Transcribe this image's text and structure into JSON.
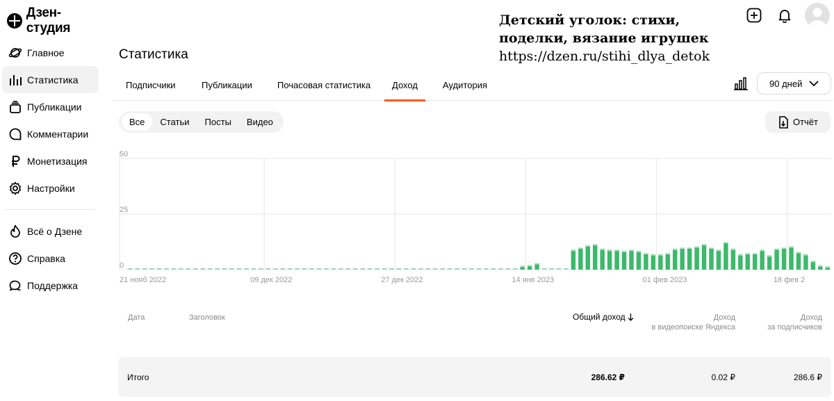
{
  "app": {
    "title": "Дзен-студия"
  },
  "sidebar": {
    "items": [
      {
        "label": "Главное",
        "icon": "planet-icon"
      },
      {
        "label": "Статистика",
        "icon": "bar-chart-icon"
      },
      {
        "label": "Публикации",
        "icon": "stack-icon"
      },
      {
        "label": "Комментарии",
        "icon": "comment-icon"
      },
      {
        "label": "Монетизация",
        "icon": "ruble-icon"
      },
      {
        "label": "Настройки",
        "icon": "gear-icon"
      }
    ],
    "secondary": [
      {
        "label": "Всё о Дзене",
        "icon": "flame-icon"
      },
      {
        "label": "Справка",
        "icon": "help-icon"
      },
      {
        "label": "Поддержка",
        "icon": "chat-icon"
      }
    ]
  },
  "header": {
    "channel_name_line1": "Детский уголок: стихи,",
    "channel_name_line2": "поделки, вязание игрушек",
    "channel_url": "https://dzen.ru/stihi_dlya_detok",
    "page_title": "Статистика"
  },
  "tabs": [
    "Подписчики",
    "Публикации",
    "Почасовая статистика",
    "Доход",
    "Аудитория"
  ],
  "active_tab": "Доход",
  "period": "90 дней",
  "filters": [
    "Все",
    "Статьи",
    "Посты",
    "Видео"
  ],
  "report_label": "Отчёт",
  "chart_data": {
    "type": "bar",
    "y_ticks": [
      "50",
      "25",
      "0"
    ],
    "ylim": [
      0,
      50
    ],
    "x_tick_labels": [
      "21 нояб 2022",
      "09 дек 2022",
      "27 дек 2022",
      "14 янв 2023",
      "01 фев 2023",
      "18 фев 2"
    ],
    "bar_color": "#3cb96a",
    "empty_color": "#9ec9b9",
    "values": [
      0,
      0,
      0,
      0,
      0,
      0,
      0,
      0,
      0,
      0,
      0,
      0,
      0,
      0,
      0,
      0,
      0,
      0,
      0,
      0,
      0,
      0,
      0,
      0,
      0,
      0,
      0,
      0,
      0,
      0,
      0,
      0,
      0,
      0,
      0,
      0,
      0,
      0,
      0,
      0,
      0,
      0,
      0,
      0,
      0,
      0,
      0,
      0,
      0,
      0,
      0,
      0,
      0,
      0,
      1.8,
      2.1,
      3.0,
      0,
      0,
      0,
      0,
      9,
      10,
      11,
      11.5,
      9.5,
      9,
      9,
      8.5,
      9,
      8.5,
      7.5,
      7,
      7,
      7.5,
      9.5,
      10,
      10,
      10.5,
      11.5,
      10,
      9,
      12.5,
      9.5,
      7,
      7.5,
      7.5,
      9,
      6.5,
      9.5,
      10,
      10.5,
      8,
      7,
      4,
      2,
      1.5
    ]
  },
  "table": {
    "columns": [
      {
        "label": "Дата"
      },
      {
        "label": "Заголовок"
      },
      {
        "label": "Общий доход"
      },
      {
        "label_line1": "Доход",
        "label_line2": "в видеопоиске Яндекса"
      },
      {
        "label_line1": "Доход",
        "label_line2": "за подписчиков"
      }
    ],
    "totals": {
      "label": "Итого",
      "total_income": "286.62 ₽",
      "video_search_income": "0.02 ₽",
      "subscriber_income": "286.6 ₽"
    }
  }
}
